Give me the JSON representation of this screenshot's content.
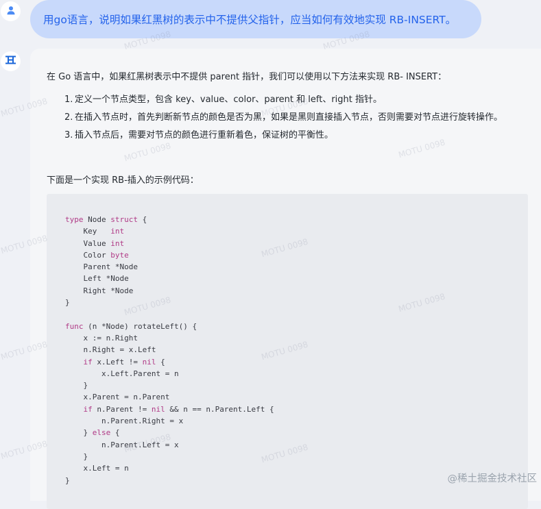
{
  "user_message": {
    "text": "用go语言，说明如果红黑树的表示中不提供父指针，应当如何有效地实现 RB-INSERT。",
    "avatar_icon": "user-icon"
  },
  "assistant_message": {
    "avatar_icon": "assistant-logo-icon",
    "intro": "在 Go 语言中，如果红黑树表示中不提供 parent 指针，我们可以使用以下方法来实现 RB- INSERT：",
    "steps": [
      {
        "num": "1.",
        "text": "定义一个节点类型，包含 key、value、color、parent 和 left、right 指针。"
      },
      {
        "num": "2.",
        "text": "在插入节点时，首先判断新节点的颜色是否为黑，如果是黑则直接插入节点，否则需要对节点进行旋转操作。"
      },
      {
        "num": "3.",
        "text": "插入节点后，需要对节点的颜色进行重新着色，保证树的平衡性。"
      }
    ],
    "code_intro": "下面是一个实现 RB-插入的示例代码：",
    "code_lines": [
      "type Node struct {",
      "    Key   int",
      "    Value int",
      "    Color byte",
      "    Parent *Node",
      "    Left *Node",
      "    Right *Node",
      "}",
      "",
      "func (n *Node) rotateLeft() {",
      "    x := n.Right",
      "    n.Right = x.Left",
      "    if x.Left != nil {",
      "        x.Left.Parent = n",
      "    }",
      "    x.Parent = n.Parent",
      "    if n.Parent != nil && n == n.Parent.Left {",
      "        n.Parent.Right = x",
      "    } else {",
      "        n.Parent.Left = x",
      "    }",
      "    x.Left = n",
      "}"
    ]
  },
  "watermark_text": "MOTU 0098",
  "footer_watermark": "@稀土掘金技术社区",
  "colors": {
    "page_bg": "#eff1f6",
    "user_bubble_bg": "#c8d9fb",
    "user_text": "#2463eb",
    "code_bg": "#e9ebef",
    "keyword": "#b03a86"
  }
}
